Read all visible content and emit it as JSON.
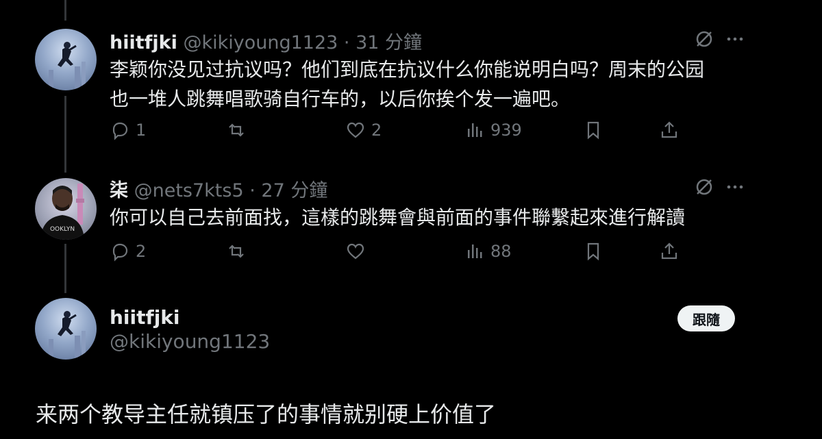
{
  "tweets": [
    {
      "name": "hiitfjki",
      "handle": "@kikiyoung1123",
      "time": "31 分鐘",
      "text_line1": "李颖你没见过抗议吗？他们到底在抗议什么你能说明白吗？周末的公园",
      "text_line2": "也一堆人跳舞唱歌骑自行车的，以后你挨个发一遍吧。",
      "replies": "1",
      "retweets": "",
      "likes": "2",
      "views": "939",
      "avatar": "spiderman-avatar"
    },
    {
      "name": "柒",
      "handle": "@nets7kts5",
      "time": "27 分鐘",
      "text_line1": "你可以自己去前面找，這樣的跳舞會與前面的事件聯繫起來進行解讀",
      "replies": "2",
      "retweets": "",
      "likes": "",
      "views": "88",
      "avatar": "man-portrait-avatar",
      "avatar_shirt_text": "OOKLYN"
    }
  ],
  "main_post": {
    "name": "hiitfjki",
    "handle": "@kikiyoung1123",
    "follow_label": "跟隨",
    "text": "来两个教导主任就镇压了的事情就别硬上价值了"
  },
  "separator": "·",
  "colors": {
    "background": "#000000",
    "text": "#e7e9ea",
    "muted": "#71767b",
    "line": "#333639",
    "button_bg": "#eff3f4"
  }
}
